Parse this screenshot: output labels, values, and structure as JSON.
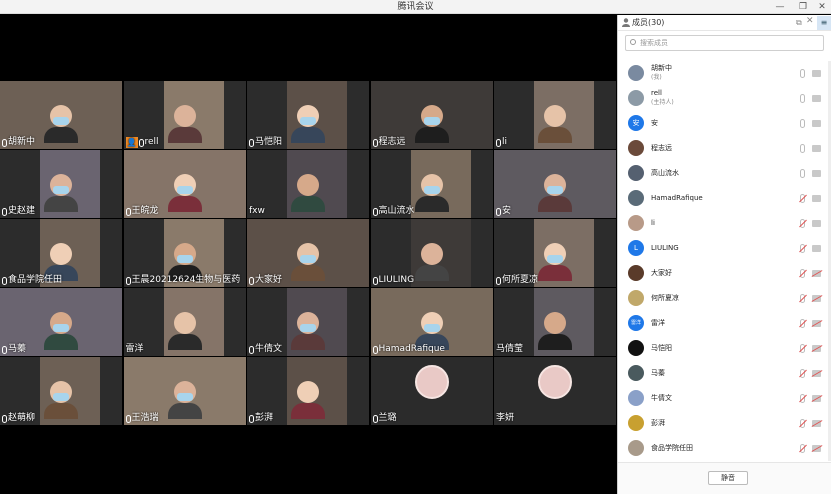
{
  "window": {
    "title": "腾讯会议",
    "controls": {
      "minimize": "—",
      "restore": "❐",
      "close": "✕"
    }
  },
  "video_tiles": [
    {
      "name": "胡新中",
      "mic": true
    },
    {
      "name": "rell",
      "mic": true,
      "host": true
    },
    {
      "name": "马恺阳",
      "mic": true
    },
    {
      "name": "程志远",
      "mic": true
    },
    {
      "name": "li",
      "mic": true
    },
    {
      "name": "史赵建",
      "mic": true
    },
    {
      "name": "王皖龙",
      "mic": true
    },
    {
      "name": "fxw",
      "mic": false
    },
    {
      "name": "高山流水",
      "mic": true
    },
    {
      "name": "安",
      "mic": true
    },
    {
      "name": "食品学院任田",
      "mic": true
    },
    {
      "name": "王晨20212624生物与医药",
      "mic": true
    },
    {
      "name": "大家好",
      "mic": true
    },
    {
      "name": "LIULING",
      "mic": true
    },
    {
      "name": "何所夏凉",
      "mic": true
    },
    {
      "name": "马蓁",
      "mic": true
    },
    {
      "name": "雷洋",
      "mic": false
    },
    {
      "name": "牛倩文",
      "mic": true
    },
    {
      "name": "HamadRafique",
      "mic": true
    },
    {
      "name": "马倩莹",
      "mic": false
    },
    {
      "name": "赵萌柳",
      "mic": true
    },
    {
      "name": "王浩瑞",
      "mic": true
    },
    {
      "name": "彭湃",
      "mic": true
    },
    {
      "name": "兰璐",
      "mic": true
    },
    {
      "name": "李妍",
      "mic": false
    }
  ],
  "panel": {
    "title": "成员(30)",
    "menu_glyph": "≡",
    "search_placeholder": "搜索成员",
    "members": [
      {
        "name": "胡新中",
        "role": "(我)",
        "avatar": "#7a8aa0",
        "initial": "",
        "muted": false,
        "cam_off": false
      },
      {
        "name": "rell",
        "role": "(主持人)",
        "avatar": "#8c9aa6",
        "initial": "",
        "muted": false,
        "cam_off": false
      },
      {
        "name": "安",
        "role": "",
        "avatar": "#1f78e8",
        "initial": "安",
        "muted": false,
        "cam_off": false
      },
      {
        "name": "程志远",
        "role": "",
        "avatar": "#6b4a3a",
        "initial": "",
        "muted": false,
        "cam_off": false
      },
      {
        "name": "高山流水",
        "role": "",
        "avatar": "#556070",
        "initial": "",
        "muted": false,
        "cam_off": false
      },
      {
        "name": "HamadRafique",
        "role": "",
        "avatar": "#5a6b78",
        "initial": "",
        "muted": true,
        "cam_off": false
      },
      {
        "name": "li",
        "role": "",
        "avatar": "#b89a88",
        "initial": "",
        "muted": true,
        "cam_off": false
      },
      {
        "name": "LIULING",
        "role": "",
        "avatar": "#1f78e8",
        "initial": "L",
        "muted": true,
        "cam_off": false
      },
      {
        "name": "大家好",
        "role": "",
        "avatar": "#5a3b2a",
        "initial": "",
        "muted": true,
        "cam_off": true
      },
      {
        "name": "何所夏凉",
        "role": "",
        "avatar": "#c0a86a",
        "initial": "",
        "muted": true,
        "cam_off": true
      },
      {
        "name": "雷洋",
        "role": "",
        "avatar": "#1f78e8",
        "initial": "雷洋",
        "muted": true,
        "cam_off": true
      },
      {
        "name": "马恺阳",
        "role": "",
        "avatar": "#111111",
        "initial": "",
        "muted": true,
        "cam_off": true
      },
      {
        "name": "马蓁",
        "role": "",
        "avatar": "#4a5a5e",
        "initial": "",
        "muted": true,
        "cam_off": true
      },
      {
        "name": "牛倩文",
        "role": "",
        "avatar": "#8aa0c8",
        "initial": "",
        "muted": true,
        "cam_off": true
      },
      {
        "name": "彭湃",
        "role": "",
        "avatar": "#c8a030",
        "initial": "",
        "muted": true,
        "cam_off": true
      },
      {
        "name": "食品学院任田",
        "role": "",
        "avatar": "#a89a8a",
        "initial": "",
        "muted": true,
        "cam_off": true
      }
    ],
    "mute_all_label": "静音"
  }
}
